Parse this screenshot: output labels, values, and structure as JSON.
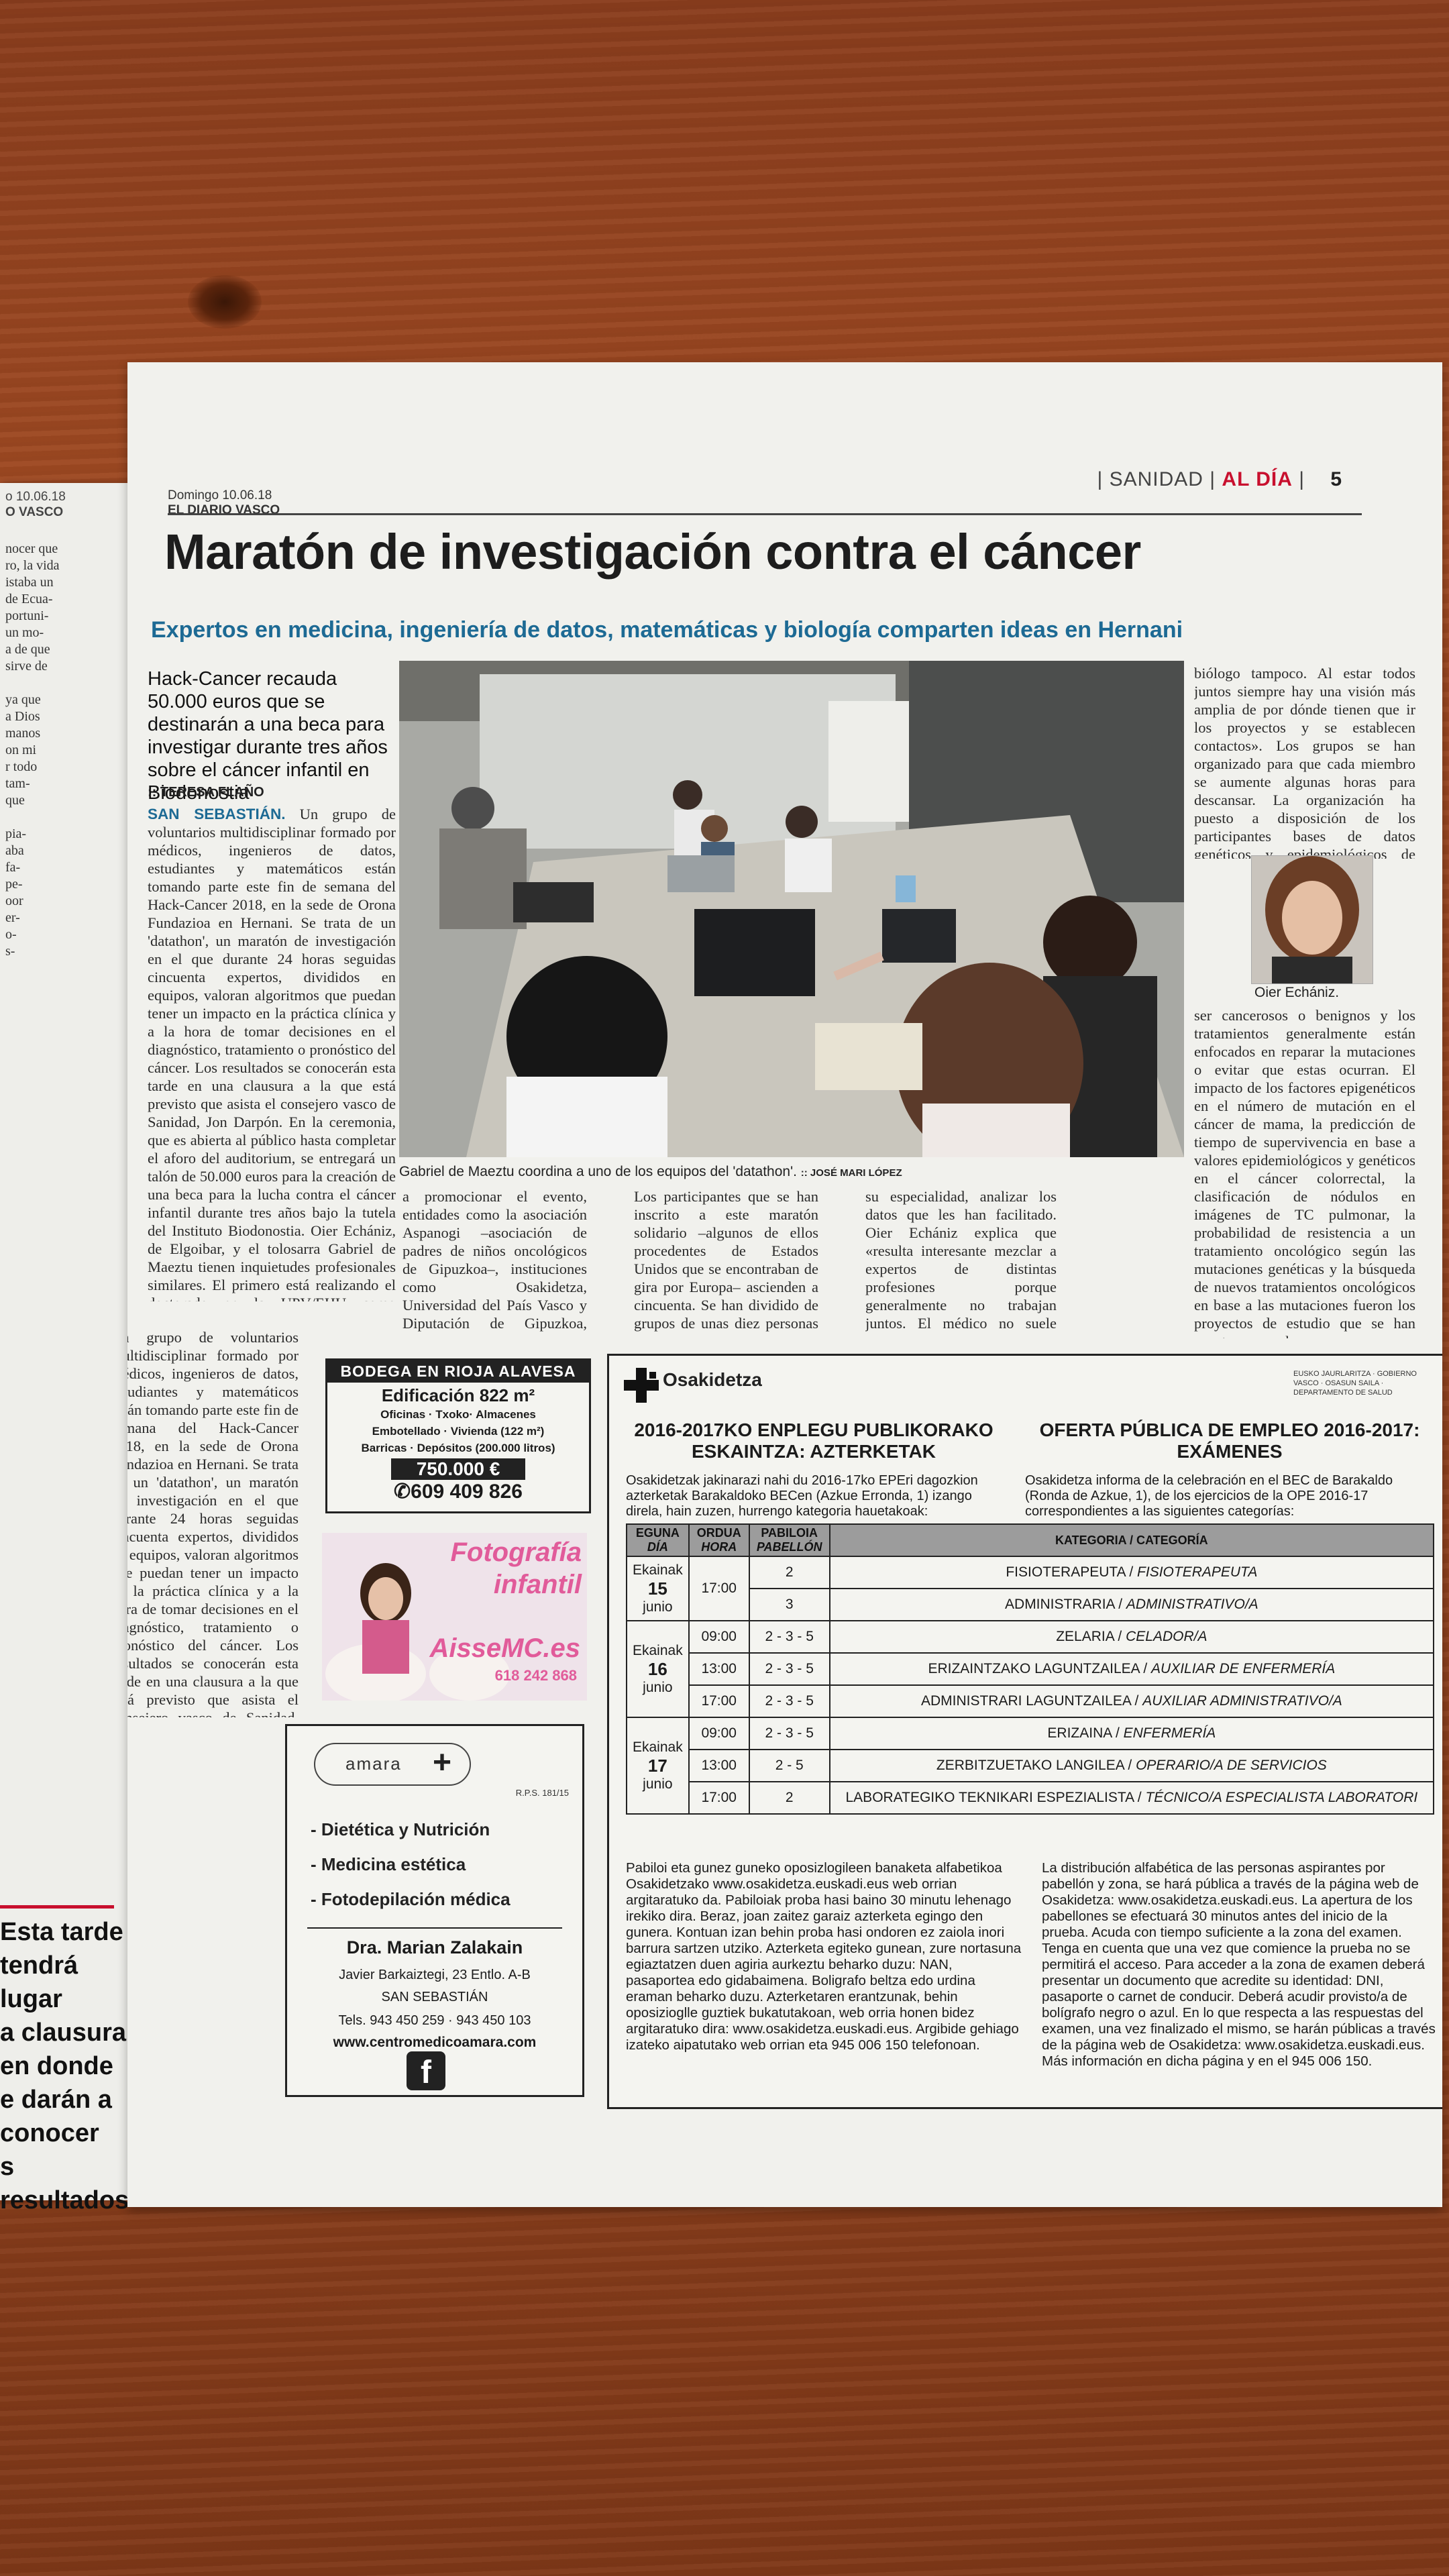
{
  "left_page": {
    "date": "o 10.06.18",
    "paper": "O VASCO",
    "lines": [
      "nocer que",
      "ro, la vida",
      "istaba un",
      "de Ecua-",
      "portuni-",
      "un mo-",
      "a de que",
      "sirve de",
      "",
      "ya que",
      "a Dios",
      "manos",
      "on mi",
      "r todo",
      "tam-",
      "que",
      "",
      "pia-",
      "aba",
      "fa-",
      "pe-",
      "oor",
      "er-",
      "o-",
      "s-",
      "",
      "",
      "",
      ""
    ],
    "pull_quote": [
      "Esta tarde tendrá lugar",
      "a clausura en donde",
      "e darán a conocer",
      "s resultados"
    ]
  },
  "masthead": {
    "date": "Domingo 10.06.18",
    "paper": "EL DIARIO VASCO"
  },
  "section": {
    "name": "SANIDAD",
    "sub": "AL DÍA",
    "page": "5"
  },
  "article": {
    "headline": "Maratón de investigación contra el cáncer",
    "subhead": "Expertos en medicina, ingeniería de datos, matemáticas y biología comparten ideas en Hernani",
    "lead": "Hack-Cancer recauda 50.000 euros que se destinarán a una beca para investigar durante tres años sobre el cáncer infantil en Biodonostia",
    "byline": "TERESA FLAÑO",
    "city": "SAN SEBASTIÁN.",
    "col1": " Un grupo de voluntarios multidisciplinar formado por médicos, ingenieros de datos, estudiantes y matemáticos están tomando parte este fin de semana del Hack-Cancer 2018, en la sede de Orona Fundazioa en Hernani. Se trata de un 'datathon', un maratón de investigación en el que durante 24 horas seguidas cincuenta expertos, divididos en equipos, valoran algoritmos que puedan tener un impacto en la práctica clínica y a la hora de tomar decisiones en el diagnóstico, tratamiento o pronóstico del cáncer. Los resultados se conocerán esta tarde en una clausura a la que está previsto que asista el consejero vasco de Sanidad, Jon Darpón. En la ceremonia, que es abierta al público hasta completar el aforo del auditorium, se entregará un talón de 50.000 euros para la creación de una beca para la lucha contra el cáncer infantil durante tres años bajo la tutela del Instituto Biodonostia. Oier Echániz, de Elgoibar, y el tolosarra Gabriel de Maeztu tienen inquietudes profesionales similares. El primero está realizando el doctorado en la UPV/EHU como investigador analista de imágenes médicas para el diagnóstico con técnicas de aprendizaje automático centrado en el cáncer; su colega es un médico fundador de la start-up Iomed. Suelen quedar en esta empresa para compartir conocimientos. De Maeztu asistió al Hack-Cancer organizado en Londres, ciudad donde surgió el proyecto en 2015 cuando cuarenta de los mejores desarrolladores y médicos del mundo se reunieron en el Google Campus para crear productos que pudieran vencer al cáncer. Pensó que la iniciativa también podía trasladarse a Donostia. Para ello contó con la ayuda de los organizadores del evento en la capital británica y de Echániz. Luego se unieron Maider Alberich y Elder Sánchez, de Naru Intelligence, empresa también dedicada a sistemas de análisis de grandes cantidades de datos que tienen el potencial de acelerar los avances en medicina. Posteriormente contactaron con el Rotary Club, que les ha ayudado",
    "col2": "a promocionar el evento, entidades como la asociación Aspanogi –asociación de padres de niños oncológicos de Gipuzkoa–, instituciones como Osakidetza, Universidad del País Vasco y Diputación de Gipuzkoa, además de empresas.",
    "col3": "Los participantes que se han inscrito a este maratón solidario –algunos de ellos procedentes de Estados Unidos que se encontraban de gira por Europa– ascienden a cincuenta. Se han dividido de grupos de unas diez personas para, cada uno desde",
    "col4": "su especialidad, analizar los datos que les han facilitado. Oier Echániz explica que «resulta interesante mezclar a expertos de distintas profesiones porque generalmente no trabajan juntos. El médico no suele hablar con un analista de datos y un",
    "col5a": "biólogo tampoco. Al estar todos juntos siempre hay una visión más amplia de por dónde tienen que ir los proyectos y se establecen contactos». Los grupos se han organizado para que cada miembro se aumente algunas horas para descansar. La organización ha puesto a disposición de los participantes bases de datos genéticos y epidemiológicos de cáncer y datos de TC de pulmón. A primera hora de la mañana de ayer, los grupos decidieron qué líneas de trabajo iban a seguir. Para ello establecieron una serie de premisas: el cáncer es el resultado de una serie de mutaciones genéticas encadenadas; los nódulos de pulmón pueden",
    "col5b": "ser cancerosos o benignos y los tratamientos generalmente están enfocados en reparar la mutaciones o evitar que estas ocurran. El impacto de los factores epigenéticos en el número de mutación en el cáncer de mama, la predicción de tiempo de supervivencia en base a valores epidemiológicos y genéticos en el cáncer colorrectal, la clasificación de nódulos en imágenes de TC pulmonar, la probabilidad de resistencia a un tratamiento oncológico según las mutaciones genéticas y la búsqueda de nuevos tratamientos oncológicos en base a las mutaciones fueron los proyectos de estudio que se han puesto en marcha.",
    "photo_caption": "Gabriel de Maeztu coordina a uno de los equipos del 'datathon'.",
    "photo_credit": ":: JOSÉ MARI LÓPEZ",
    "portrait_caption": "Oier Echániz."
  },
  "ad_bodega": {
    "title": "BODEGA EN RIOJA ALAVESA",
    "size": "Edificación 822 m²",
    "line1": "Oficinas · Txoko· Almacenes",
    "line2": "Embotellado · Vivienda (122 m²)",
    "line3": "Barricas · Depósitos (200.000 litros)",
    "price": "750.000 €",
    "phone": "609 409 826"
  },
  "ad_foto": {
    "title1": "Fotografía",
    "title2": "infantil",
    "web": "AisseMC.es",
    "phone": "618 242 868"
  },
  "ad_amara": {
    "logo": "amara",
    "ref": "R.P.S. 181/15",
    "services": [
      "- Dietética y Nutrición",
      "- Medicina estética",
      "- Fotodepilación médica"
    ],
    "doctor": "Dra. Marian Zalakain",
    "address1": "Javier Barkaiztegi, 23 Entlo. A-B",
    "address2": "SAN SEBASTIÁN",
    "phones": "Tels. 943 450 259 · 943 450 103",
    "web": "www.centromedicoamara.com",
    "fb": "f"
  },
  "osakidetza": {
    "brand": "Osakidetza",
    "gov": "EUSKO JAURLARITZA · GOBIERNO VASCO · OSASUN SAILA · DEPARTAMENTO DE SALUD",
    "title_eu": "2016-2017KO ENPLEGU PUBLIKORAKO ESKAINTZA: AZTERKETAK",
    "title_es": "OFERTA PÚBLICA DE EMPLEO 2016-2017: EXÁMENES",
    "intro_eu": "Osakidetzak jakinarazi nahi du 2016-17ko EPEri dagozkion azterketak Barakaldoko BECen (Azkue Erronda, 1) izango direla, hain zuzen, hurrengo kategoria hauetakoak:",
    "intro_es": "Osakidetza informa de la celebración en el BEC de Barakaldo (Ronda de Azkue, 1), de los ejercicios de la OPE 2016-17 correspondientes a las siguientes categorías:",
    "headers": {
      "day": "EGUNA",
      "day_es": "DÍA",
      "hour": "ORDUA",
      "hour_es": "HORA",
      "pav": "PABILOIA",
      "pav_es": "PABELLÓN",
      "cat": "KATEGORIA / CATEGORÍA"
    },
    "days": [
      {
        "label": "Ekainak",
        "num": "15",
        "month": "junio",
        "rows": [
          {
            "hour": "17:00",
            "pav": "2",
            "cat_eu": "FISIOTERAPEUTA",
            "cat_es": "FISIOTERAPEUTA"
          },
          {
            "hour": "",
            "pav": "3",
            "cat_eu": "ADMINISTRARIA",
            "cat_es": "ADMINISTRATIVO/A"
          }
        ]
      },
      {
        "label": "Ekainak",
        "num": "16",
        "month": "junio",
        "rows": [
          {
            "hour": "09:00",
            "pav": "2 - 3 - 5",
            "cat_eu": "ZELARIA",
            "cat_es": "CELADOR/A"
          },
          {
            "hour": "13:00",
            "pav": "2 - 3 - 5",
            "cat_eu": "ERIZAINTZAKO LAGUNTZAILEA",
            "cat_es": "AUXILIAR DE ENFERMERÍA"
          },
          {
            "hour": "17:00",
            "pav": "2 - 3 - 5",
            "cat_eu": "ADMINISTRARI LAGUNTZAILEA",
            "cat_es": "AUXILIAR ADMINISTRATIVO/A"
          }
        ]
      },
      {
        "label": "Ekainak",
        "num": "17",
        "month": "junio",
        "rows": [
          {
            "hour": "09:00",
            "pav": "2 - 3 - 5",
            "cat_eu": "ERIZAINA",
            "cat_es": "ENFERMERÍA"
          },
          {
            "hour": "13:00",
            "pav": "2 - 5",
            "cat_eu": "ZERBITZUETAKO LANGILEA",
            "cat_es": "OPERARIO/A DE SERVICIOS"
          },
          {
            "hour": "17:00",
            "pav": "2",
            "cat_eu": "LABORATEGIKO TEKNIKARI ESPEZIALISTA",
            "cat_es": "TÉCNICO/A ESPECIALISTA LABORATORI"
          }
        ]
      }
    ],
    "foot_eu": "Pabiloi eta gunez guneko oposizlogileen banaketa alfabetikoa Osakidetzako www.osakidetza.euskadi.eus web orrian argitaratuko da. Pabiloiak proba hasi baino 30 minutu lehenago irekiko dira. Beraz, joan zaitez garaiz azterketa egingo den gunera. Kontuan izan behin proba hasi ondoren ez zaiola inori barrura sartzen utziko. Azterketa egiteko gunean, zure nortasuna egiaztatzen duen agiria aurkeztu beharko duzu: NAN, pasaportea edo gidabaimena. Boligrafo beltza edo urdina eraman beharko duzu. Azterketaren erantzunak, behin oposizioglle guztiek bukatutakoan, web orria honen bidez argitaratuko dira: www.osakidetza.euskadi.eus. Argibide gehiago izateko aipatutako web orrian eta 945 006 150 telefonoan.",
    "foot_es": "La distribución alfabética de las personas aspirantes por pabellón y zona, se hará pública a través de la página web de Osakidetza: www.osakidetza.euskadi.eus. La apertura de los pabellones se efectuará 30 minutos antes del inicio de la prueba. Acuda con tiempo suficiente a la zona del examen. Tenga en cuenta que una vez que comience la prueba no se permitirá el acceso. Para acceder a la zona de examen deberá presentar un documento que acredite su identidad: DNI, pasaporte o carnet de conducir. Deberá acudir provisto/a de bolígrafo negro o azul. En lo que respecta a las respuestas del examen, una vez finalizado el mismo, se harán públicas a través de la página web de Osakidetza: www.osakidetza.euskadi.eus. Más información en dicha página y en el 945 006 150."
  }
}
